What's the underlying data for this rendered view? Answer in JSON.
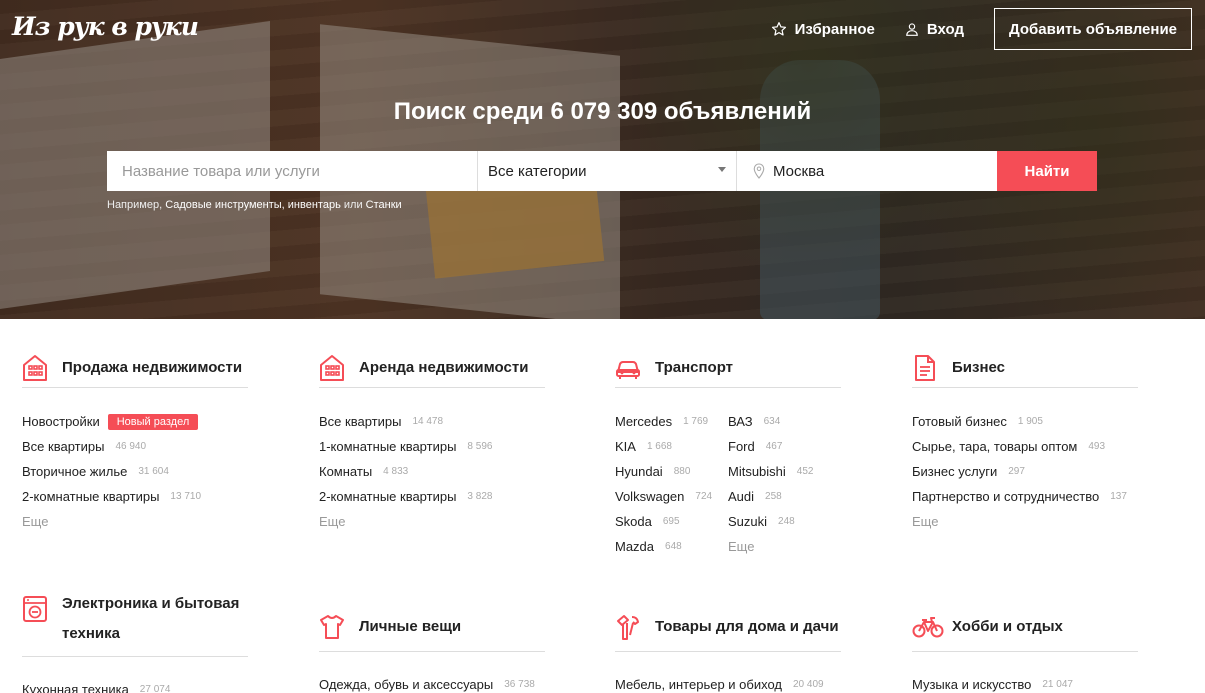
{
  "header": {
    "logo": "Из рук в руки",
    "favorites": "Избранное",
    "login": "Вход",
    "add_listing": "Добавить объявление"
  },
  "hero": {
    "title": "Поиск среди 6 079 309 объявлений"
  },
  "search": {
    "placeholder": "Название товара или услуги",
    "category": "Все категории",
    "city": "Москва",
    "button": "Найти",
    "hint_prefix": "Например,",
    "hint_link1": "Садовые инструменты, инвентарь",
    "hint_or": "или",
    "hint_link2": "Станки"
  },
  "accent_color": "#f54d56",
  "categories": [
    {
      "title": "Продажа недвижимости",
      "icon": "building-icon",
      "items": [
        {
          "label": "Новостройки",
          "badge": "Новый раздел"
        },
        {
          "label": "Все квартиры",
          "count": "46 940"
        },
        {
          "label": "Вторичное жилье",
          "count": "31 604"
        },
        {
          "label": "2-комнатные квартиры",
          "count": "13 710"
        }
      ],
      "more": "Еще"
    },
    {
      "title": "Аренда недвижимости",
      "icon": "building-icon",
      "items": [
        {
          "label": "Все квартиры",
          "count": "14 478"
        },
        {
          "label": "1-комнатные квартиры",
          "count": "8 596"
        },
        {
          "label": "Комнаты",
          "count": "4 833"
        },
        {
          "label": "2-комнатные квартиры",
          "count": "3 828"
        }
      ],
      "more": "Еще"
    },
    {
      "title": "Транспорт",
      "icon": "car-icon",
      "col1": [
        {
          "label": "Mercedes",
          "count": "1 769"
        },
        {
          "label": "KIA",
          "count": "1 668"
        },
        {
          "label": "Hyundai",
          "count": "880"
        },
        {
          "label": "Volkswagen",
          "count": "724"
        },
        {
          "label": "Skoda",
          "count": "695"
        },
        {
          "label": "Mazda",
          "count": "648"
        }
      ],
      "col2": [
        {
          "label": "ВАЗ",
          "count": "634"
        },
        {
          "label": "Ford",
          "count": "467"
        },
        {
          "label": "Mitsubishi",
          "count": "452"
        },
        {
          "label": "Audi",
          "count": "258"
        },
        {
          "label": "Suzuki",
          "count": "248"
        }
      ],
      "more": "Еще"
    },
    {
      "title": "Бизнес",
      "icon": "document-icon",
      "items": [
        {
          "label": "Готовый бизнес",
          "count": "1 905"
        },
        {
          "label": "Сырье, тара, товары оптом",
          "count": "493"
        },
        {
          "label": "Бизнес услуги",
          "count": "297"
        },
        {
          "label": "Партнерство и сотрудничество",
          "count": "137"
        }
      ],
      "more": "Еще"
    },
    {
      "title": "Электроника и бытовая техника",
      "icon": "washing-machine-icon",
      "items": [
        {
          "label": "Кухонная техника",
          "count": "27 074"
        }
      ]
    },
    {
      "title": "Личные вещи",
      "icon": "tshirt-icon",
      "items": [
        {
          "label": "Одежда, обувь и аксессуары",
          "count": "36 738"
        }
      ]
    },
    {
      "title": "Товары для дома и дачи",
      "icon": "tools-icon",
      "items": [
        {
          "label": "Мебель, интерьер и обиход",
          "count": "20 409"
        }
      ]
    },
    {
      "title": "Хобби и отдых",
      "icon": "bicycle-icon",
      "items": [
        {
          "label": "Музыка и искусство",
          "count": "21 047"
        }
      ]
    }
  ]
}
